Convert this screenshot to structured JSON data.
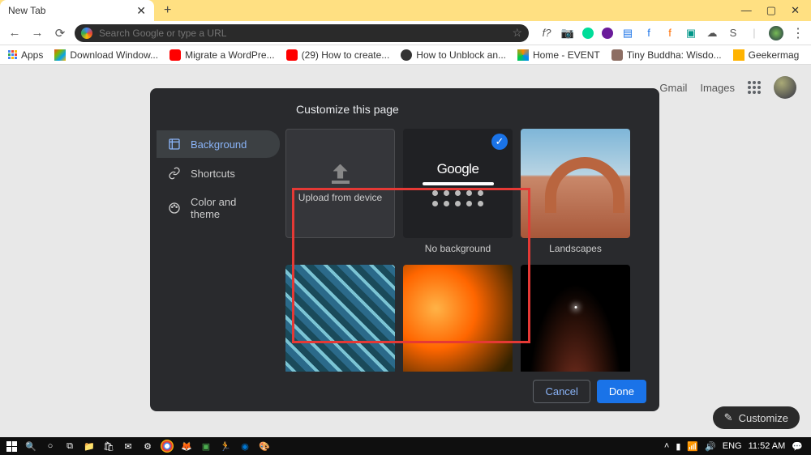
{
  "tab": {
    "title": "New Tab"
  },
  "omnibox": {
    "placeholder": "Search Google or type a URL"
  },
  "navbar_icons": {
    "f_query": "f?"
  },
  "bookmarks": {
    "apps": "Apps",
    "items": [
      {
        "label": "Download Window...",
        "color": "#0078d4"
      },
      {
        "label": "Migrate a WordPre...",
        "color": "#ff0000"
      },
      {
        "label": "(29) How to create...",
        "color": "#ff0000"
      },
      {
        "label": "How to Unblock an...",
        "color": "#333"
      },
      {
        "label": "Home - EVENT",
        "color": "#ff9800"
      },
      {
        "label": "Tiny Buddha: Wisdo...",
        "color": "#795548"
      },
      {
        "label": "Geekermag",
        "color": "#ffb300"
      }
    ]
  },
  "corner": {
    "gmail": "Gmail",
    "images": "Images"
  },
  "dialog": {
    "title": "Customize this page",
    "sidebar": [
      {
        "label": "Background",
        "icon": "frame"
      },
      {
        "label": "Shortcuts",
        "icon": "link"
      },
      {
        "label": "Color and theme",
        "icon": "palette"
      }
    ],
    "tiles": {
      "upload": "Upload from device",
      "nobg": "No background",
      "nobg_logo": "Google",
      "landscapes": "Landscapes"
    },
    "buttons": {
      "cancel": "Cancel",
      "done": "Done"
    }
  },
  "customize": "Customize",
  "taskbar": {
    "lang": "ENG",
    "time": "11:52 AM"
  }
}
